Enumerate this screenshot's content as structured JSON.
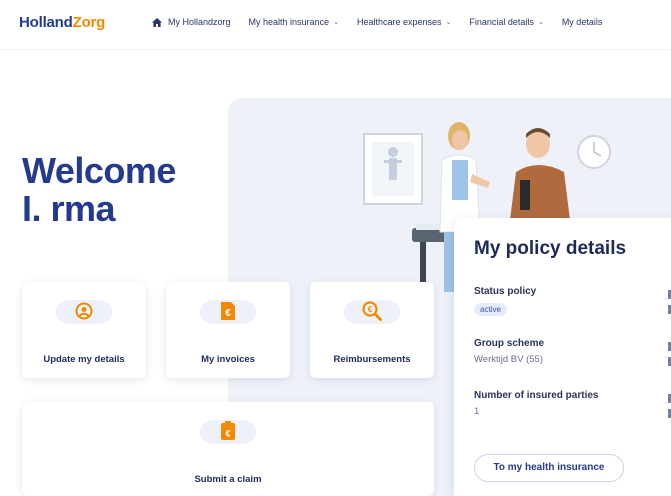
{
  "brand": {
    "part1": "Holland",
    "part2": "Zorg"
  },
  "nav": [
    {
      "label": "My Hollandzorg",
      "dropdown": false
    },
    {
      "label": "My health insurance",
      "dropdown": true
    },
    {
      "label": "Healthcare expenses",
      "dropdown": true
    },
    {
      "label": "Financial details",
      "dropdown": true
    },
    {
      "label": "My details",
      "dropdown": false
    }
  ],
  "welcome": {
    "line1": "Welcome",
    "line2": "I. rma"
  },
  "tiles": [
    {
      "label": "Update my details",
      "icon": "user-circle-icon"
    },
    {
      "label": "My invoices",
      "icon": "invoice-icon"
    },
    {
      "label": "Reimbursements",
      "icon": "search-euro-icon"
    },
    {
      "label": "Submit a claim",
      "icon": "claim-icon"
    }
  ],
  "policy": {
    "title": "My policy details",
    "status_label": "Status policy",
    "status_value": "active",
    "group_label": "Group scheme",
    "group_value": "Werktijd BV (55)",
    "insured_label": "Number of insured parties",
    "insured_value": "1",
    "button": "To my health insurance"
  },
  "colors": {
    "brand_blue": "#243a8f",
    "brand_orange": "#f08a00",
    "hero_bg": "#eef2f8"
  }
}
